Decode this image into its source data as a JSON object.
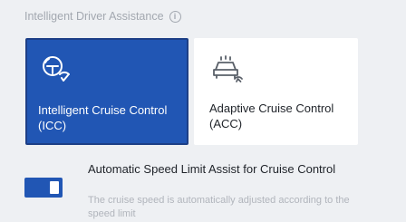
{
  "section": {
    "title": "Intelligent Driver Assistance",
    "info_icon": "info-icon",
    "info_glyph": "i"
  },
  "cards": [
    {
      "label": "Intelligent Cruise Control (ICC)",
      "icon": "intelligent-cruise-icon",
      "selected": true
    },
    {
      "label": "Adaptive Cruise Control (ACC)",
      "icon": "adaptive-cruise-icon",
      "selected": false
    }
  ],
  "speed_limit_assist": {
    "title": "Automatic Speed Limit Assist for Cruise Control",
    "description": "The cruise speed is automatically adjusted according to the speed limit",
    "enabled": true
  },
  "colors": {
    "accent": "#2156b4",
    "background": "#eef0f3",
    "card_unselected": "#ffffff",
    "muted_text": "#a3a8b0"
  }
}
